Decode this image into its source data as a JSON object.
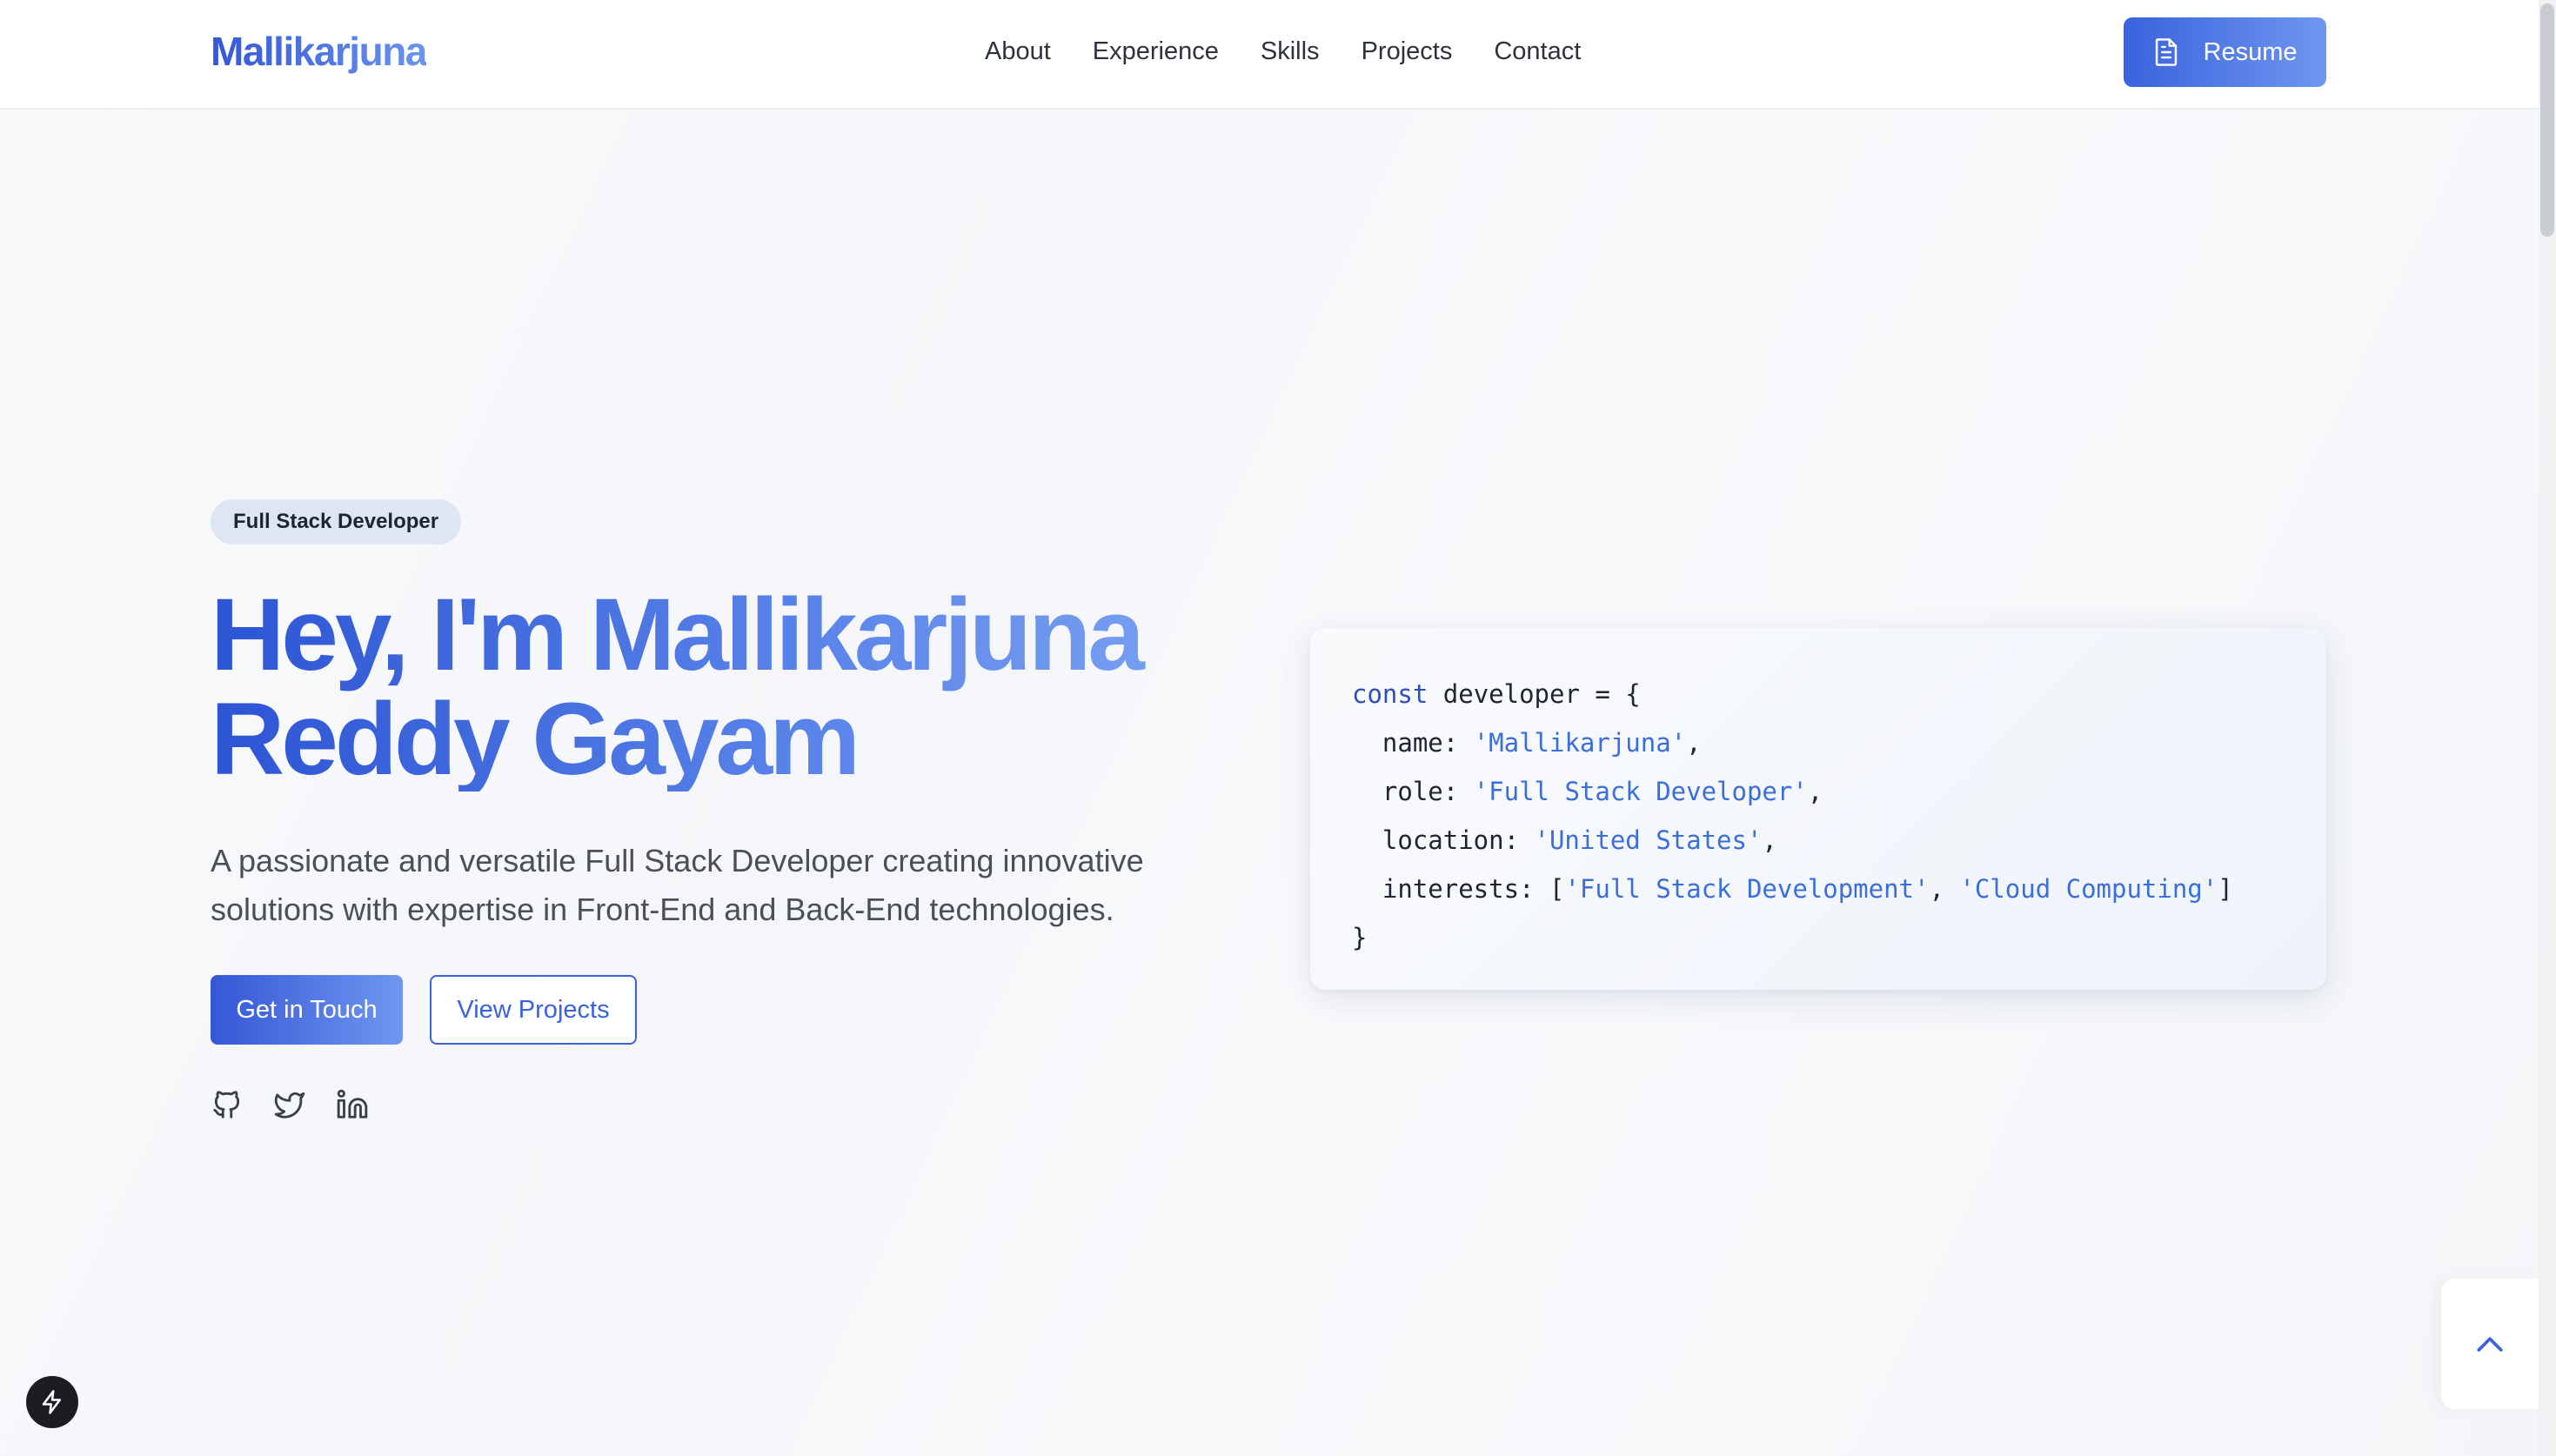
{
  "header": {
    "logo": "Mallikarjuna",
    "nav": [
      "About",
      "Experience",
      "Skills",
      "Projects",
      "Contact"
    ],
    "resume_label": "Resume"
  },
  "hero": {
    "badge": "Full Stack Developer",
    "title_line1": "Hey, I'm Mallikarjuna",
    "title_line2": "Reddy Gayam",
    "description": "A passionate and versatile Full Stack Developer creating innovative solutions with expertise in Front-End and Back-End technologies.",
    "primary_cta": "Get in Touch",
    "secondary_cta": "View Projects",
    "socials": [
      "github-icon",
      "twitter-icon",
      "linkedin-icon"
    ]
  },
  "code": {
    "line1_kw": "const",
    "line1_rest": " developer = {",
    "name_key": "  name: ",
    "name_val": "'Mallikarjuna'",
    "role_key": "  role: ",
    "role_val": "'Full Stack Developer'",
    "location_key": "  location: ",
    "location_val": "'United States'",
    "interests_key": "  interests: [",
    "interest1": "'Full Stack Development'",
    "interest2": "'Cloud Computing'",
    "close": "}"
  },
  "colors": {
    "accent": "#3a62dd",
    "accent_light": "#6e97ef",
    "badge_bg": "#dfe6f3"
  }
}
